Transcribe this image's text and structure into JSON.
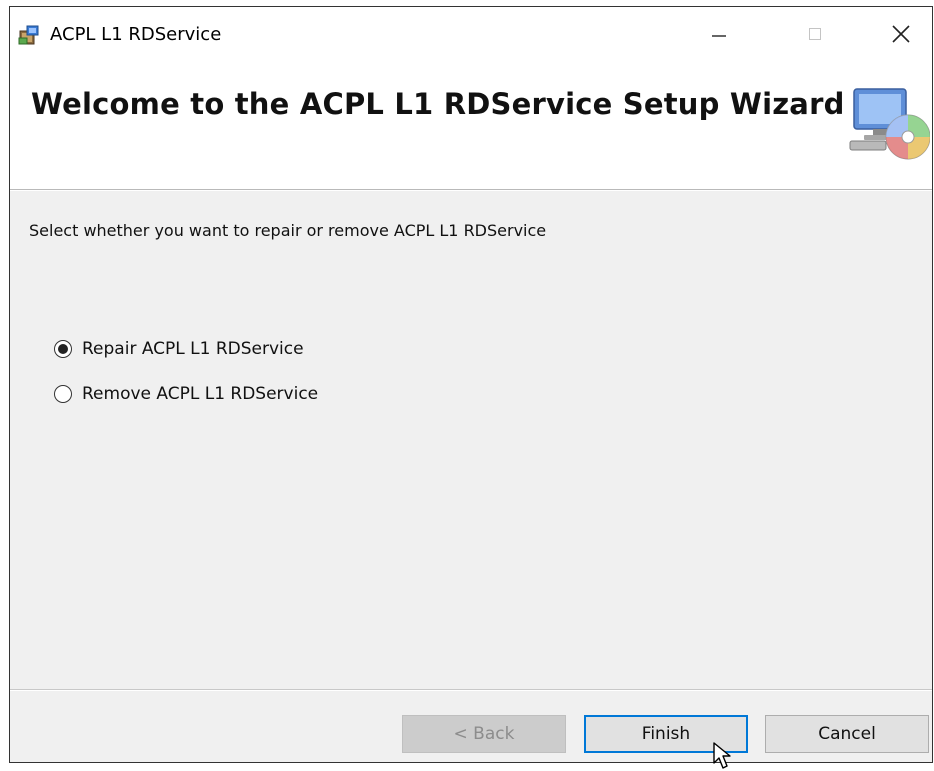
{
  "window": {
    "title": "ACPL L1 RDService"
  },
  "header": {
    "title": "Welcome to the ACPL L1 RDService Setup Wizard",
    "icon": "computer-cd-icon"
  },
  "body": {
    "instruction": "Select whether you want to repair or remove ACPL L1 RDService",
    "options": [
      {
        "label": "Repair ACPL L1 RDService",
        "selected": true
      },
      {
        "label": "Remove ACPL L1 RDService",
        "selected": false
      }
    ]
  },
  "buttons": {
    "back": {
      "label": "< Back",
      "enabled": false
    },
    "finish": {
      "label": "Finish",
      "focused": true
    },
    "cancel": {
      "label": "Cancel"
    }
  },
  "colors": {
    "accent": "#0078d7",
    "body_bg": "#f0f0f0",
    "disabled_button": "#cccccc"
  }
}
